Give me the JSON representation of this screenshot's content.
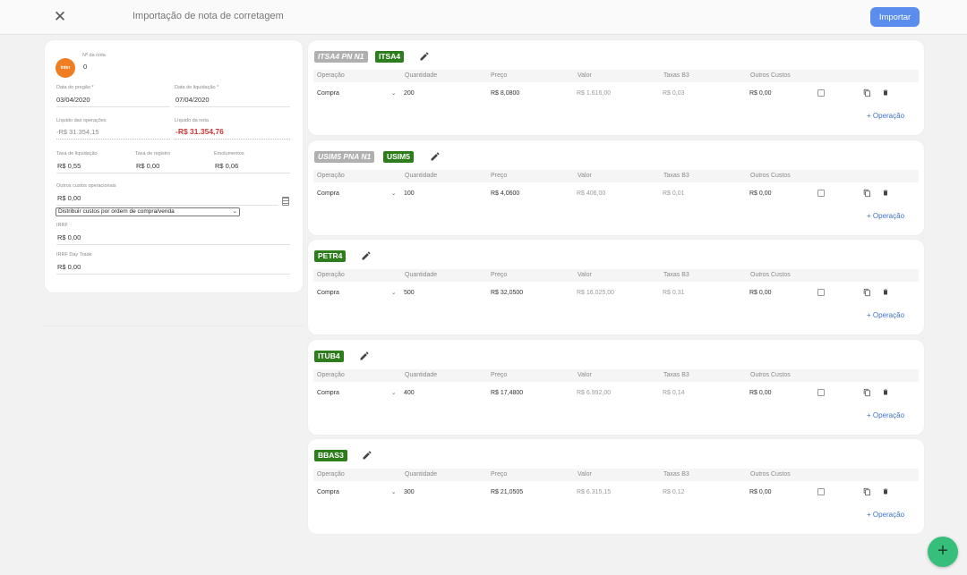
{
  "header": {
    "close_icon": "close-icon",
    "title": "Importação de nota de corretagem",
    "import_label": "Importar"
  },
  "note": {
    "logo_text": "inter",
    "number_label": "Nº da nota",
    "number_value": "0",
    "trade_date_label": "Data do pregão *",
    "trade_date_value": "03/04/2020",
    "settlement_date_label": "Data de liquidação *",
    "settlement_date_value": "07/04/2020",
    "net_ops_label": "Líquido das operações",
    "net_ops_value": "-R$ 31.354,15",
    "net_note_label": "Líquido da nota",
    "net_note_value": "-R$ 31.354,76",
    "settlement_fee_label": "Taxa de liquidação",
    "settlement_fee_value": "R$ 0,55",
    "registration_fee_label": "Taxa de registro",
    "registration_fee_value": "R$ 0,00",
    "emoluments_label": "Emolumentos",
    "emoluments_value": "R$ 0,06",
    "other_costs_label": "Outros custos operacionais",
    "other_costs_value": "R$ 0,00",
    "distribution_selected": "Distribuir custos por ordem de compra/venda",
    "irrf_label": "IRRF",
    "irrf_value": "R$ 0,00",
    "irrf_daytrade_label": "IRRF Day Trade",
    "irrf_daytrade_value": "R$ 0,00"
  },
  "columns": {
    "operation": "Operação",
    "quantity": "Quantidade",
    "price": "Preço",
    "value": "Valor",
    "b3_fees": "Taxas B3",
    "other_costs": "Outros Custos"
  },
  "add_operation_label": "+ Operação",
  "securities": [
    {
      "raw_ticker": "ITSA4 PN N1",
      "ticker": "ITSA4",
      "operation": "Compra",
      "quantity": "200",
      "price": "R$ 8,0800",
      "value": "R$ 1.616,00",
      "b3_fees": "R$ 0,03",
      "other_costs": "R$ 0,00"
    },
    {
      "raw_ticker": "USIM5 PNA N1",
      "ticker": "USIM5",
      "operation": "Compra",
      "quantity": "100",
      "price": "R$ 4,0600",
      "value": "R$ 406,00",
      "b3_fees": "R$ 0,01",
      "other_costs": "R$ 0,00"
    },
    {
      "raw_ticker": "",
      "ticker": "PETR4",
      "operation": "Compra",
      "quantity": "500",
      "price": "R$ 32,0500",
      "value": "R$ 16.025,00",
      "b3_fees": "R$ 0,31",
      "other_costs": "R$ 0,00"
    },
    {
      "raw_ticker": "",
      "ticker": "ITUB4",
      "operation": "Compra",
      "quantity": "400",
      "price": "R$ 17,4800",
      "value": "R$ 6.992,00",
      "b3_fees": "R$ 0,14",
      "other_costs": "R$ 0,00"
    },
    {
      "raw_ticker": "",
      "ticker": "BBAS3",
      "operation": "Compra",
      "quantity": "300",
      "price": "R$ 21,0505",
      "value": "R$ 6.315,15",
      "b3_fees": "R$ 0,12",
      "other_costs": "R$ 0,00"
    }
  ],
  "fab_label": "+"
}
